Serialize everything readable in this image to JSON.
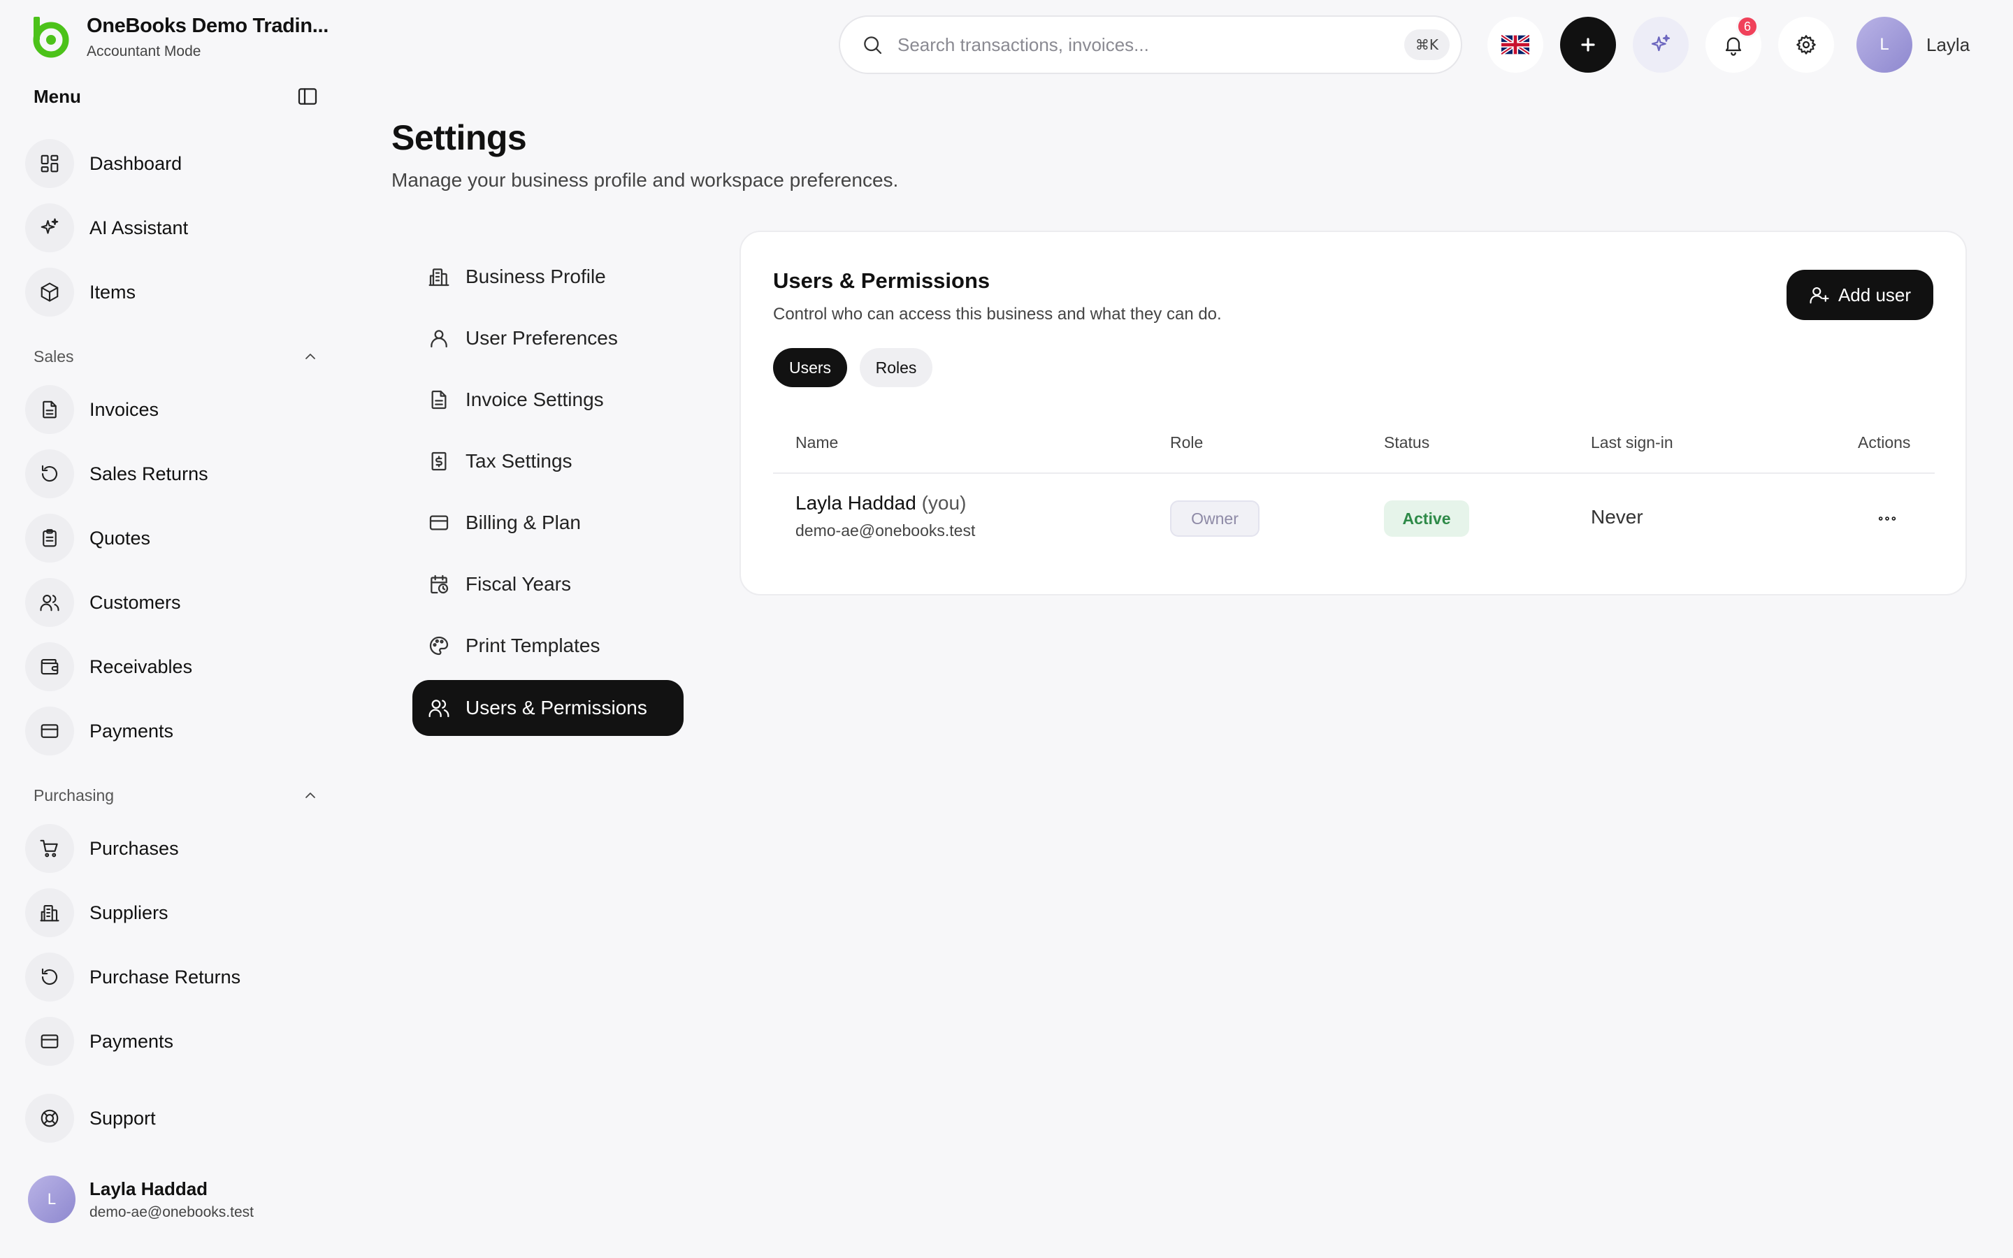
{
  "brand": {
    "name": "OneBooks Demo Tradin...",
    "mode": "Accountant Mode"
  },
  "menu": {
    "title": "Menu"
  },
  "nav": {
    "top": [
      {
        "label": "Dashboard",
        "icon": "dashboard-icon"
      },
      {
        "label": "AI Assistant",
        "icon": "sparkles-icon"
      },
      {
        "label": "Items",
        "icon": "box-icon"
      }
    ],
    "sales_label": "Sales",
    "sales": [
      {
        "label": "Invoices",
        "icon": "file-text-icon"
      },
      {
        "label": "Sales Returns",
        "icon": "rotate-icon"
      },
      {
        "label": "Quotes",
        "icon": "clipboard-icon"
      },
      {
        "label": "Customers",
        "icon": "users-icon"
      },
      {
        "label": "Receivables",
        "icon": "wallet-icon"
      },
      {
        "label": "Payments",
        "icon": "credit-card-icon"
      }
    ],
    "purchasing_label": "Purchasing",
    "purchasing": [
      {
        "label": "Purchases",
        "icon": "cart-icon"
      },
      {
        "label": "Suppliers",
        "icon": "building-icon"
      },
      {
        "label": "Purchase Returns",
        "icon": "rotate-icon"
      },
      {
        "label": "Payments",
        "icon": "credit-card-icon"
      }
    ],
    "support": {
      "label": "Support",
      "icon": "lifebuoy-icon"
    }
  },
  "current_user": {
    "initial": "L",
    "name": "Layla Haddad",
    "email": "demo-ae@onebooks.test"
  },
  "topbar": {
    "search_placeholder": "Search transactions, invoices...",
    "shortcut": "⌘K",
    "notifications_count": "6",
    "profile_initial": "L",
    "profile_name": "Layla"
  },
  "page": {
    "title": "Settings",
    "subtitle": "Manage your business profile and workspace preferences."
  },
  "settings_nav": [
    {
      "label": "Business Profile",
      "icon": "building-icon"
    },
    {
      "label": "User Preferences",
      "icon": "user-icon"
    },
    {
      "label": "Invoice Settings",
      "icon": "file-text-icon"
    },
    {
      "label": "Tax Settings",
      "icon": "receipt-dollar-icon"
    },
    {
      "label": "Billing & Plan",
      "icon": "credit-card-icon"
    },
    {
      "label": "Fiscal Years",
      "icon": "calendar-clock-icon"
    },
    {
      "label": "Print Templates",
      "icon": "palette-icon"
    },
    {
      "label": "Users & Permissions",
      "icon": "users-icon",
      "active": true
    }
  ],
  "card": {
    "title": "Users & Permissions",
    "subtitle": "Control who can access this business and what they can do.",
    "add_user_label": "Add user",
    "tabs": [
      "Users",
      "Roles"
    ],
    "columns": [
      "Name",
      "Role",
      "Status",
      "Last sign-in",
      "Actions"
    ],
    "rows": [
      {
        "name": "Layla Haddad",
        "you": "(you)",
        "email": "demo-ae@onebooks.test",
        "role": "Owner",
        "status": "Active",
        "last_sign_in": "Never"
      }
    ]
  },
  "colors": {
    "brand_green": "#4cc21a",
    "active_bg": "#121212",
    "status_active_bg": "#e6f4ea",
    "status_active_text": "#2e8a48",
    "badge_red": "#f0415a",
    "avatar_purple": "#a59fdc"
  }
}
